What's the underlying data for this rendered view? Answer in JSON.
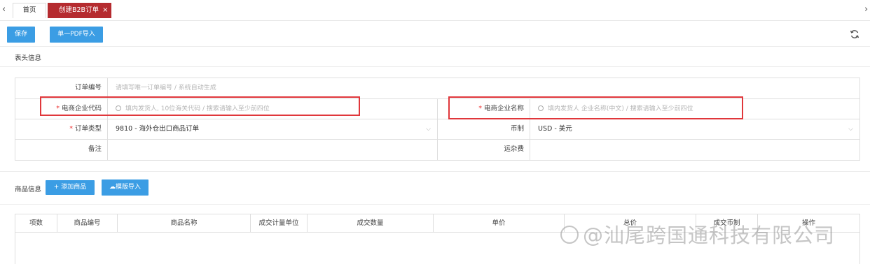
{
  "tabs": {
    "home": "首页",
    "active": "创建B2B订单",
    "close_glyph": "×",
    "prev_glyph": "‹",
    "next_glyph": "›"
  },
  "toolbar": {
    "save": "保存",
    "pdf_import": "单一PDF导入",
    "refresh_icon": "refresh-icon"
  },
  "header_section": {
    "title": "表头信息",
    "required_mark": "*",
    "order_no_label": "订单编号",
    "order_no_placeholder": "请填写唯一订单编号 / 系统自动生成",
    "company_code_label": "电商企业代码",
    "company_code_placeholder": "填内发货人, 10位海关代码 / 搜索请输入至少前四位",
    "company_name_label": "电商企业名称",
    "company_name_placeholder": "填内发货人 企业名称(中文) / 搜索请输入至少前四位",
    "order_type_label": "订单类型",
    "order_type_value": "9810 - 海外仓出口商品订单",
    "currency_label": "币制",
    "currency_value": "USD - 美元",
    "remark_label": "备注",
    "freight_label": "运杂费",
    "highlight_color": "#e0373b"
  },
  "goods_section": {
    "title": "商品信息",
    "add_button": "+ 添加商品",
    "template_import": "模版导入",
    "columns": [
      "项数",
      "商品编号",
      "商品名称",
      "成交计量单位",
      "成交数量",
      "单价",
      "总价",
      "成交币制",
      "操作"
    ]
  },
  "watermark": "@汕尾跨国通科技有限公司",
  "colors": {
    "accent_blue": "#3b9de4",
    "active_tab": "#b52b2f"
  }
}
